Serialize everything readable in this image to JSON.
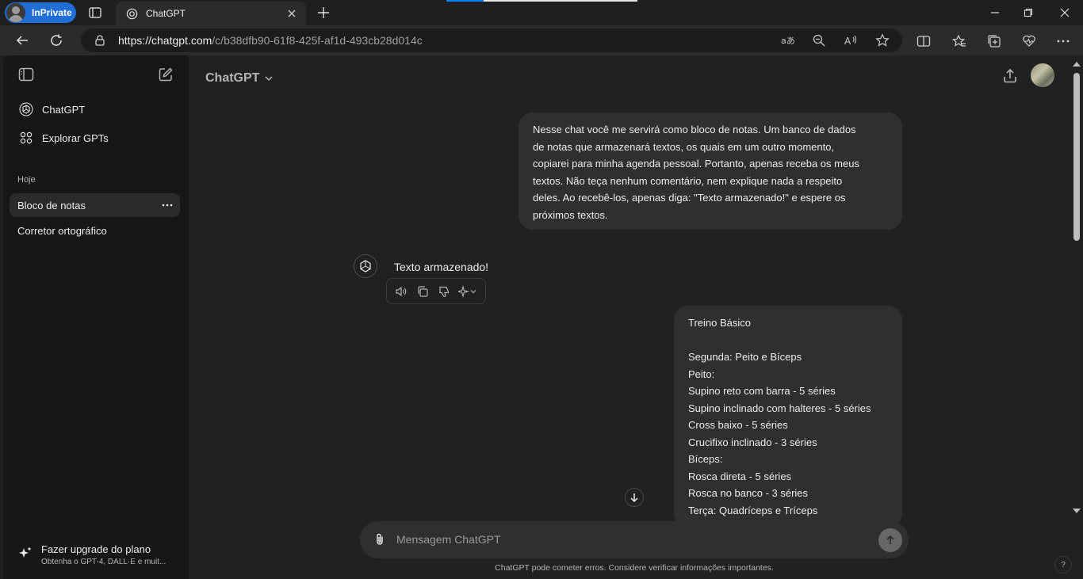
{
  "browser": {
    "profile_label": "InPrivate",
    "tab_title": "ChatGPT",
    "url_host": "https://chatgpt.com",
    "url_path": "/c/b38dfb90-61f8-425f-af1d-493cb28d014c"
  },
  "sidebar": {
    "items": [
      {
        "label": "ChatGPT",
        "icon": "openai-logo-icon"
      },
      {
        "label": "Explorar GPTs",
        "icon": "grid-icon"
      }
    ],
    "section_label": "Hoje",
    "history": [
      {
        "label": "Bloco de notas",
        "active": true
      },
      {
        "label": "Corretor ortográfico",
        "active": false
      }
    ],
    "upgrade": {
      "title": "Fazer upgrade do plano",
      "subtitle": "Obtenha o GPT-4, DALL·E e muit..."
    }
  },
  "header": {
    "model_name": "ChatGPT"
  },
  "messages": {
    "user_1": "Nesse chat você me servirá como bloco de notas. Um banco de dados\nde notas que armazenará textos, os quais em um outro momento,\ncopiarei para minha agenda pessoal. Portanto, apenas receba os meus\ntextos. Não teça nenhum comentário, nem explique nada a respeito\ndeles. Ao recebê-los, apenas diga: \"Texto armazenado!\" e espere os\npróximos textos.",
    "assistant_1": "Texto armazenado!",
    "user_2": "Treino Básico\n\nSegunda: Peito e Bíceps\nPeito:\nSupino reto com barra - 5 séries\nSupino inclinado com halteres - 5 séries\nCross baixo - 5 séries\nCrucifixo inclinado - 3 séries\nBíceps:\nRosca direta - 5 séries\nRosca no banco - 3 séries\nTerça: Quadríceps e Tríceps"
  },
  "composer": {
    "placeholder": "Mensagem ChatGPT"
  },
  "footer": {
    "disclaimer": "ChatGPT pode cometer erros. Considere verificar informações importantes.",
    "help": "?"
  },
  "colors": {
    "accent": "#1f6fd6",
    "sidebar_bg": "#171717",
    "main_bg": "#212121",
    "bubble_bg": "#2f2f2f"
  }
}
